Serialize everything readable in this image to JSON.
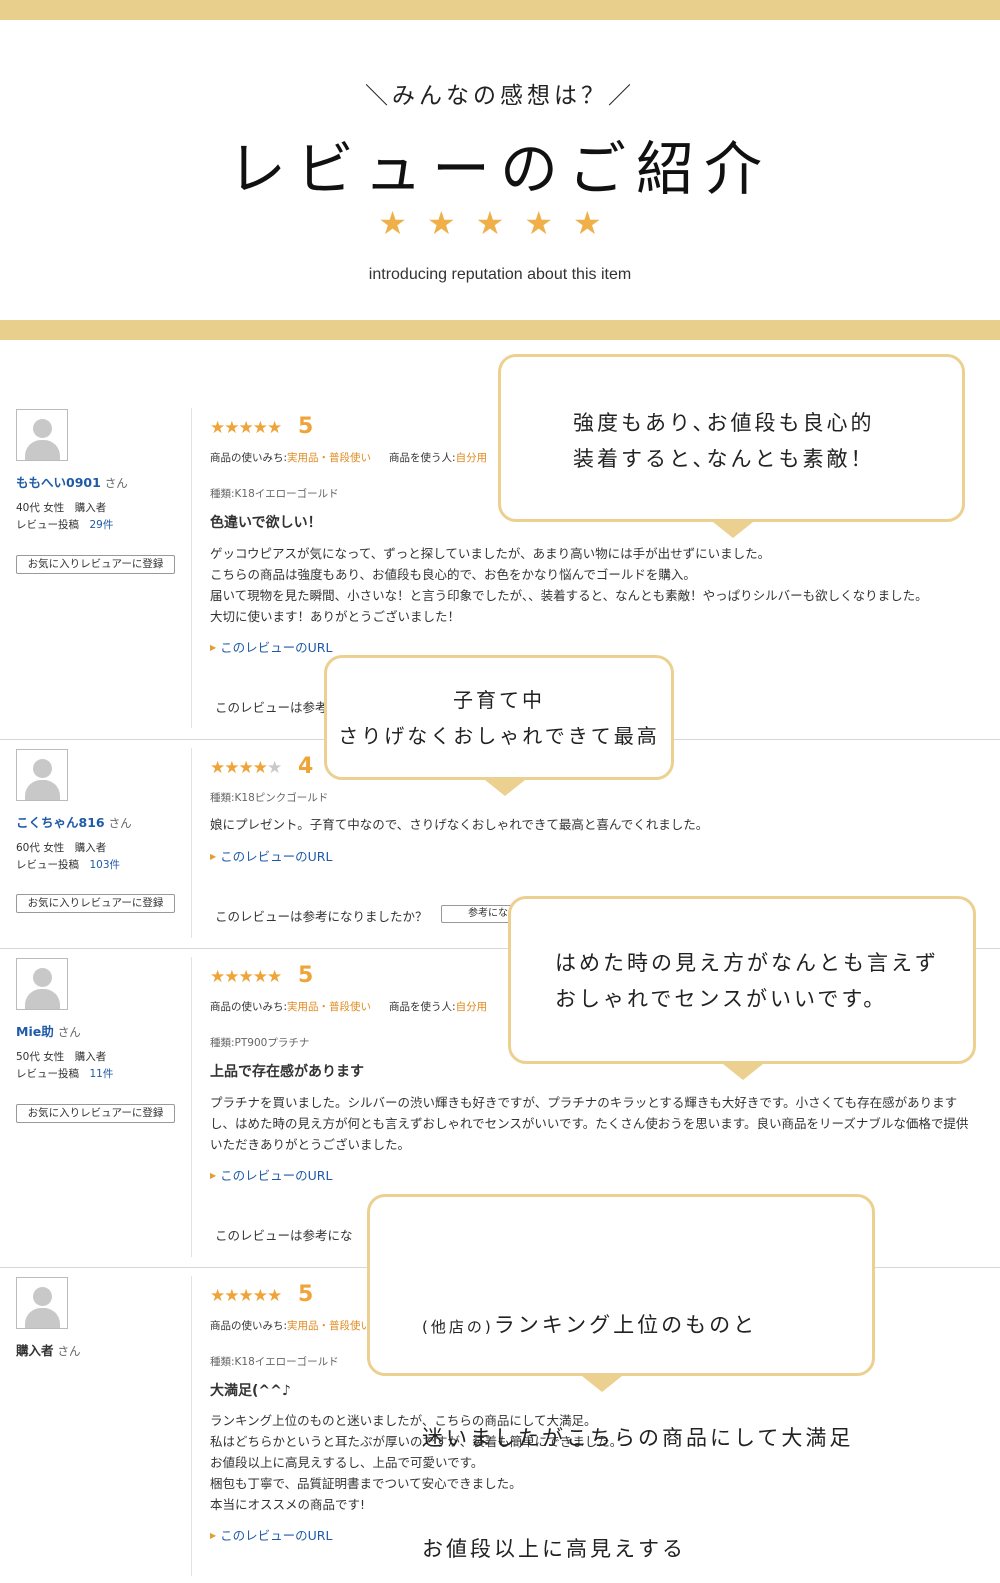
{
  "hero": {
    "subtitle": "＼みんなの感想は？／",
    "title": "レビューのご紹介",
    "stars": "★★★★★",
    "english": "introducing reputation about this item"
  },
  "labels": {
    "san": "さん",
    "buyer": "購入者",
    "posts_label": "レビュー投稿",
    "fav_button": "お気に入りレビュアーに登録",
    "usage_label": "商品の使いみち:",
    "user_label": "商品を使う人:",
    "review_url": "このレビューのURL",
    "helpful_question": "このレビューは参考になりましたか？",
    "helpful_button": "参考にな",
    "helpful_truncated": "このレビューは参考",
    "helpful_truncated_3": "このレビューは参考にな"
  },
  "reviews": [
    {
      "username": "ももへい0901",
      "demographic": "40代 女性",
      "posts": "29件",
      "rating": 5,
      "stars": "★★★★★",
      "usage": "実用品・普段使い",
      "user": "自分用",
      "variant": "種類:K18イエローゴールド",
      "title": "色違いで欲しい！",
      "body": [
        "ゲッコウピアスが気になって、ずっと探していましたが、あまり高い物には手が出せずにいました。",
        "こちらの商品は強度もあり、お値段も良心的で、お色をかなり悩んでゴールドを購入。",
        "届いて現物を見た瞬間、小さいな！と言う印象でしたが、、装着すると、なんとも素敵！やっぱりシルバーも欲しくなりました。",
        "大切に使います！ありがとうございました！"
      ]
    },
    {
      "username": "こくちゃん816",
      "demographic": "60代 女性",
      "posts": "103件",
      "rating": 4,
      "stars_on": "★★★★",
      "stars_off": "★",
      "variant": "種類:K18ピンクゴールド",
      "body": [
        "娘にプレゼント。子育て中なので、さりげなくおしゃれできて最高と喜んでくれました。"
      ]
    },
    {
      "username": "Mie助",
      "demographic": "50代 女性",
      "posts": "11件",
      "rating": 5,
      "stars": "★★★★★",
      "usage": "実用品・普段使い",
      "user": "自分用",
      "variant": "種類:PT900プラチナ",
      "title": "上品で存在感があります",
      "body": [
        "プラチナを買いました。シルバーの渋い輝きも好きですが、プラチナのキラッとする輝きも大好きです。小さくても存在感があります",
        "し、はめた時の見え方が何とも言えずおしゃれでセンスがいいです。たくさん使おうを思います。良い商品をリーズナブルな価格で提供",
        "いただきありがとうございました。"
      ]
    },
    {
      "username": "購入者",
      "rating": 5,
      "stars": "★★★★★",
      "usage": "実用品・普段使い",
      "variant": "種類:K18イエローゴールド",
      "title": "大満足(^^♪",
      "body": [
        "ランキング上位のものと迷いましたが、こちらの商品にして大満足。",
        "私はどちらかというと耳たぶが厚いのですが、装着も簡単にできました。",
        "お値段以上に高見えするし、上品で可愛いです。",
        "梱包も丁寧で、品質証明書までついて安心できました。",
        "本当にオススメの商品です!"
      ]
    }
  ],
  "bubbles": [
    {
      "line1": "強度もあり､お値段も良心的",
      "line2": "装着すると､なんとも素敵！"
    },
    {
      "line1": "子育て中",
      "line2": "さりげなくおしゃれできて最高"
    },
    {
      "line1": "はめた時の見え方がなんとも言えず",
      "line2": "おしゃれでセンスがいいです。"
    },
    {
      "prefix": "(他店の)",
      "line1": "ランキング上位のものと",
      "line2": "迷いましたがこちらの商品にして大満足",
      "line3": "お値段以上に高見えする"
    }
  ],
  "colors": {
    "gold_bar": "#e9cf8c",
    "bubble_border": "#ecd090",
    "star": "#efa43a",
    "link": "#1f5aa8"
  }
}
